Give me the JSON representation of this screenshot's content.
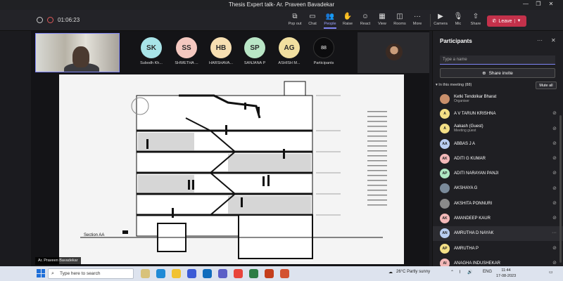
{
  "window": {
    "title": "Thesis Expert talk- Ar. Praveen Bavadekar"
  },
  "toolbar": {
    "timer": "01:06:23",
    "items": [
      {
        "label": "Pop out",
        "icon": "popout-icon"
      },
      {
        "label": "Chat",
        "icon": "chat-icon"
      },
      {
        "label": "People",
        "icon": "people-icon"
      },
      {
        "label": "Raise",
        "icon": "raise-hand-icon"
      },
      {
        "label": "React",
        "icon": "react-icon"
      },
      {
        "label": "View",
        "icon": "view-icon"
      },
      {
        "label": "Rooms",
        "icon": "rooms-icon"
      },
      {
        "label": "More",
        "icon": "more-icon"
      },
      {
        "label": "Camera",
        "icon": "camera-icon"
      },
      {
        "label": "Mic",
        "icon": "mic-icon"
      },
      {
        "label": "Share",
        "icon": "share-icon"
      }
    ],
    "leave_label": "Leave"
  },
  "stage": {
    "participants": [
      {
        "initials": "SK",
        "name": "Subodh Kh...",
        "color": "#a8e4e8"
      },
      {
        "initials": "SS",
        "name": "SHWETHA ...",
        "color": "#f4c8c0"
      },
      {
        "initials": "HB",
        "name": "HARSHAVA...",
        "color": "#f7dfb2"
      },
      {
        "initials": "SP",
        "name": "SANJANA P",
        "color": "#b9e6c6"
      },
      {
        "initials": "AG",
        "name": "ASHISH M...",
        "color": "#f1dfa0"
      }
    ],
    "count_tile": {
      "count": "88",
      "label": "Participants"
    },
    "presenter": "Ar. Praveen Bavadekar",
    "slide_label": "Section AA"
  },
  "panel": {
    "title": "Participants",
    "search_placeholder": "Type a name",
    "share_invite": "Share invite",
    "in_meeting": "In this meeting (88)",
    "mute_all": "Mute all",
    "people": [
      {
        "name": "Ketki Tendolkar Bharat",
        "sub": "Organiser",
        "initials": "",
        "color": "#c98f6b"
      },
      {
        "name": "A V TARUN KRISHNA",
        "sub": "",
        "initials": "A",
        "color": "#f3df86"
      },
      {
        "name": "Aakash (Guest)",
        "sub": "Meeting guest",
        "initials": "A",
        "color": "#f3df86"
      },
      {
        "name": "ABBAS J A",
        "sub": "",
        "initials": "AA",
        "color": "#b8cdf0"
      },
      {
        "name": "ADITI G KUMAR",
        "sub": "",
        "initials": "AK",
        "color": "#f3b8b8"
      },
      {
        "name": "ADITI NARAYAN PANJI",
        "sub": "",
        "initials": "AP",
        "color": "#aee6c1"
      },
      {
        "name": "AKSHAYA G",
        "sub": "",
        "initials": "",
        "color": "#7a8a9a"
      },
      {
        "name": "AKSHITA PONNURI",
        "sub": "",
        "initials": "",
        "color": "#8a8a8a"
      },
      {
        "name": "AMANDEEP KAUR",
        "sub": "",
        "initials": "AK",
        "color": "#f3b8b8"
      },
      {
        "name": "AMRUTHA D NAYAK",
        "sub": "",
        "initials": "AN",
        "color": "#b8cdf0"
      },
      {
        "name": "AMRUTHA P",
        "sub": "",
        "initials": "AP",
        "color": "#f3df86"
      },
      {
        "name": "ANAGHA INDUSHEKAR",
        "sub": "",
        "initials": "AI",
        "color": "#f3b8b8"
      }
    ]
  },
  "taskbar": {
    "search_placeholder": "Type here to search",
    "weather": "26°C  Partly sunny",
    "lang": "ENG",
    "time": "11:44",
    "date": "17-08-2023"
  }
}
